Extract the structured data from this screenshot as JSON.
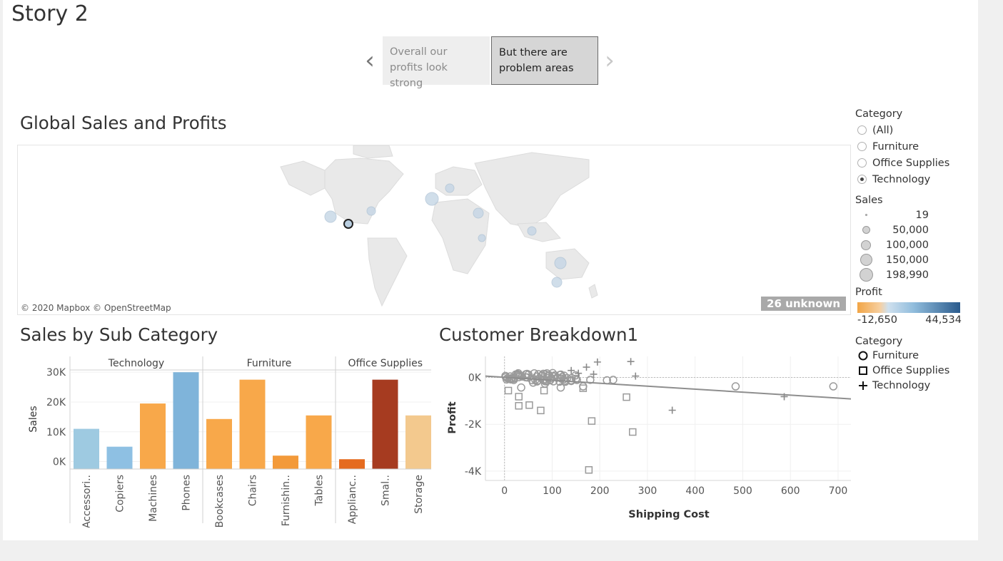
{
  "story": {
    "title": "Story 2",
    "points": [
      {
        "text": "Overall our profits look strong"
      },
      {
        "text": "But there are problem areas"
      }
    ]
  },
  "map": {
    "title": "Global Sales and Profits",
    "credit": "© 2020 Mapbox © OpenStreetMap",
    "unknown_label": "26 unknown"
  },
  "bar": {
    "title": "Sales by Sub Category"
  },
  "scatter": {
    "title": "Customer Breakdown1"
  },
  "legend": {
    "category_filter": {
      "title": "Category",
      "options": [
        "(All)",
        "Furniture",
        "Office Supplies",
        "Technology"
      ],
      "selected": "Technology"
    },
    "sales": {
      "title": "Sales",
      "values": [
        "19",
        "50,000",
        "100,000",
        "150,000",
        "198,990"
      ]
    },
    "profit": {
      "title": "Profit",
      "min": "-12,650",
      "max": "44,534",
      "colors": [
        "#f2a546",
        "#2a5a8c"
      ]
    },
    "category_shape": {
      "title": "Category",
      "items": [
        {
          "label": "Furniture",
          "shape": "circle"
        },
        {
          "label": "Office Supplies",
          "shape": "square"
        },
        {
          "label": "Technology",
          "shape": "plus"
        }
      ]
    }
  },
  "chart_data": [
    {
      "type": "bar",
      "title": "Sales by Sub Category",
      "ylabel": "Sales",
      "yticks": [
        "0K",
        "10K",
        "20K",
        "30K"
      ],
      "ylim": [
        -2500,
        31000
      ],
      "groups": [
        {
          "name": "Technology",
          "categories": [
            {
              "label": "Accessori..",
              "value": 11000,
              "color": "#9ecae1"
            },
            {
              "label": "Copiers",
              "value": 5000,
              "color": "#8ec0e3"
            },
            {
              "label": "Machines",
              "value": 19500,
              "color": "#f8a84a"
            },
            {
              "label": "Phones",
              "value": 30000,
              "color": "#7fb4da"
            }
          ]
        },
        {
          "name": "Furniture",
          "categories": [
            {
              "label": "Bookcases",
              "value": 14300,
              "color": "#f8a84a"
            },
            {
              "label": "Chairs",
              "value": 27500,
              "color": "#f8a84a"
            },
            {
              "label": "Furnishin..",
              "value": 2000,
              "color": "#f39a3a"
            },
            {
              "label": "Tables",
              "value": 15500,
              "color": "#f8a84a"
            }
          ]
        },
        {
          "name": "Office Supplies",
          "categories": [
            {
              "label": "Applianc..",
              "value": 800,
              "color": "#e56b1f"
            },
            {
              "label": "Smal..",
              "value": 27500,
              "color": "#a63b20"
            },
            {
              "label": "Storage",
              "value": 15500,
              "color": "#f3c98e"
            }
          ]
        }
      ]
    },
    {
      "type": "scatter",
      "title": "Customer Breakdown1",
      "xlabel": "Shipping Cost",
      "ylabel": "Profit",
      "xticks": [
        "0",
        "100",
        "200",
        "300",
        "400",
        "500",
        "600",
        "700"
      ],
      "yticks": [
        "0K",
        "-2K",
        "-4K"
      ],
      "xlim": [
        -40,
        730
      ],
      "ylim": [
        -4400,
        900
      ],
      "trend_line": [
        [
          -40,
          60
        ],
        [
          730,
          -920
        ]
      ],
      "points": [
        {
          "x": 215,
          "y": -120,
          "shape": "circle"
        },
        {
          "x": 228,
          "y": -100,
          "shape": "circle"
        },
        {
          "x": 485,
          "y": -380,
          "shape": "circle"
        },
        {
          "x": 690,
          "y": -380,
          "shape": "circle"
        },
        {
          "x": 118,
          "y": -430,
          "shape": "circle"
        },
        {
          "x": 165,
          "y": -380,
          "shape": "circle"
        },
        {
          "x": 35,
          "y": -430,
          "shape": "circle"
        },
        {
          "x": 60,
          "y": -220,
          "shape": "circle"
        },
        {
          "x": 85,
          "y": -260,
          "shape": "circle"
        },
        {
          "x": 140,
          "y": -120,
          "shape": "circle"
        },
        {
          "x": 180,
          "y": -100,
          "shape": "circle"
        },
        {
          "x": 195,
          "y": 660,
          "shape": "plus"
        },
        {
          "x": 265,
          "y": 680,
          "shape": "plus"
        },
        {
          "x": 275,
          "y": 60,
          "shape": "plus"
        },
        {
          "x": 172,
          "y": 440,
          "shape": "plus"
        },
        {
          "x": 140,
          "y": 300,
          "shape": "plus"
        },
        {
          "x": 187,
          "y": 140,
          "shape": "plus"
        },
        {
          "x": 155,
          "y": 180,
          "shape": "plus"
        },
        {
          "x": 352,
          "y": -1400,
          "shape": "plus"
        },
        {
          "x": 587,
          "y": -820,
          "shape": "plus"
        },
        {
          "x": 8,
          "y": -560,
          "shape": "square"
        },
        {
          "x": 30,
          "y": -820,
          "shape": "square"
        },
        {
          "x": 30,
          "y": -1210,
          "shape": "square"
        },
        {
          "x": 52,
          "y": -1180,
          "shape": "square"
        },
        {
          "x": 76,
          "y": -1410,
          "shape": "square"
        },
        {
          "x": 83,
          "y": -560,
          "shape": "square"
        },
        {
          "x": 165,
          "y": -460,
          "shape": "square"
        },
        {
          "x": 256,
          "y": -840,
          "shape": "square"
        },
        {
          "x": 183,
          "y": -1860,
          "shape": "square"
        },
        {
          "x": 269,
          "y": -2330,
          "shape": "square"
        },
        {
          "x": 177,
          "y": -3950,
          "shape": "square"
        }
      ]
    }
  ]
}
